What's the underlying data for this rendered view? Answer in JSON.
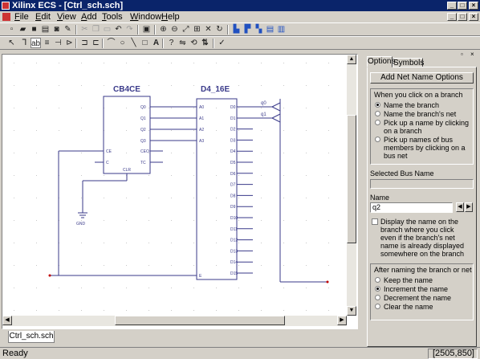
{
  "window": {
    "title": "Xilinx ECS - [Ctrl_sch.sch]",
    "min": "_",
    "max": "□",
    "close": "×"
  },
  "menu": [
    {
      "u": "F",
      "rest": "ile"
    },
    {
      "u": "E",
      "rest": "dit"
    },
    {
      "u": "V",
      "rest": "iew"
    },
    {
      "u": "A",
      "rest": "dd"
    },
    {
      "u": "T",
      "rest": "ools"
    },
    {
      "u": "W",
      "rest": "indow"
    },
    {
      "u": "H",
      "rest": "elp"
    }
  ],
  "schematic": {
    "cb4ce": {
      "name": "CB4CE",
      "pins_left": [
        "CE",
        "C"
      ],
      "pin_clr": "CLR",
      "pins_right": [
        "Q0",
        "Q1",
        "Q2",
        "Q3",
        "CEO",
        "TC"
      ]
    },
    "d4_16e": {
      "name": "D4_16E",
      "pins_left": [
        "A0",
        "A1",
        "A2",
        "A3",
        "E"
      ],
      "pins_right": [
        "D0",
        "D1",
        "D2",
        "D3",
        "D4",
        "D5",
        "D6",
        "D7",
        "D8",
        "D9",
        "D10",
        "D11",
        "D12",
        "D13",
        "D14",
        "D15"
      ]
    },
    "gnd_label": "GND",
    "net_labels": [
      "q0",
      "q1"
    ]
  },
  "doc_tab": "Ctrl_sch.sch",
  "status": {
    "text": "Ready",
    "coords": "[2505,850]"
  },
  "panel": {
    "tabs": [
      "Options",
      "Symbols"
    ],
    "header_button": "Add Net Name Options",
    "click_group": {
      "title": "When you click on a branch",
      "options": [
        "Name the branch",
        "Name the branch's net",
        "Pick up a name by clicking on a branch",
        "Pick up names of bus members by clicking on a bus net"
      ],
      "selected": 0
    },
    "selected_bus_label": "Selected Bus Name",
    "selected_bus_value": "",
    "name_label": "Name",
    "name_value": "q2",
    "display_checkbox": "Display the name on the branch where you click even if the branch's net name is already displayed somewhere on the branch",
    "display_checked": false,
    "after_group": {
      "title": "After naming the branch or net",
      "options": [
        "Keep the name",
        "Increment the name",
        "Decrement the name",
        "Clear the name"
      ],
      "selected": 1
    }
  }
}
